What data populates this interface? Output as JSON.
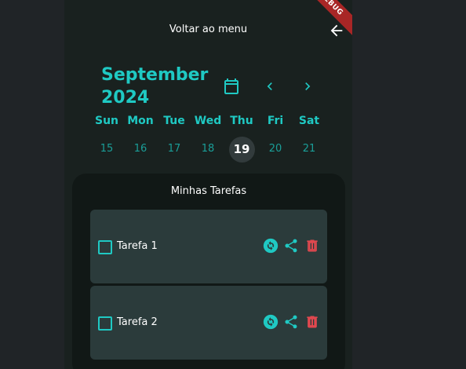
{
  "header": {
    "title": "Voltar ao menu",
    "back_icon": "arrow-back-icon"
  },
  "debug": "DEBUG",
  "calendar": {
    "month_line1": "September",
    "month_line2": "2024",
    "icons": {
      "calendar": "calendar-icon",
      "prev": "chevron-left-icon",
      "next": "chevron-right-icon"
    },
    "weekdays": [
      "Sun",
      "Mon",
      "Tue",
      "Wed",
      "Thu",
      "Fri",
      "Sat"
    ],
    "days": [
      "15",
      "16",
      "17",
      "18",
      "19",
      "20",
      "21"
    ],
    "selected_index": 4
  },
  "tasks": {
    "title": "Minhas Tarefas",
    "items": [
      {
        "label": "Tarefa 1",
        "checked": false
      },
      {
        "label": "Tarefa 2",
        "checked": false
      }
    ],
    "action_icons": [
      "sync-icon",
      "share-icon",
      "trash-icon"
    ]
  },
  "colors": {
    "accent": "#1fc9c3",
    "background": "#19211f",
    "panel": "#111816",
    "card": "#2b3b3b",
    "delete": "#e0484f"
  }
}
